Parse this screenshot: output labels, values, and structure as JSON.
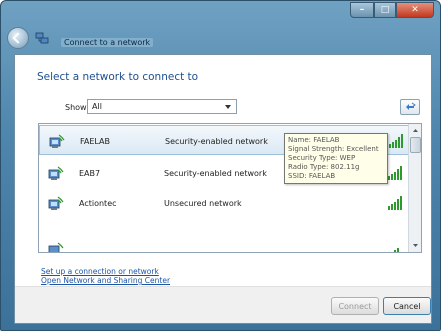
{
  "window": {
    "title": "Connect to a network",
    "caption": {
      "minimize": "–",
      "maximize": "□",
      "close": "✕"
    }
  },
  "main": {
    "heading": "Select a network to connect to",
    "show_label": "Show",
    "show_value": "All"
  },
  "networks": [
    {
      "name": "FAELAB",
      "security": "Security-enabled network",
      "signal_icon": "signal-excellent-icon",
      "selected": true
    },
    {
      "name": "EAB7",
      "security": "Security-enabled network",
      "signal_icon": "signal-excellent-icon",
      "selected": false
    },
    {
      "name": "Actiontec",
      "security": "Unsecured network",
      "signal_icon": "signal-excellent-icon",
      "selected": false
    },
    {
      "name": "",
      "security": "",
      "signal_icon": "signal-low-icon",
      "selected": false
    }
  ],
  "tooltip": {
    "name": "Name: FAELAB",
    "signal": "Signal Strength: Excellent",
    "security": "Security Type: WEP",
    "radio": "Radio Type: 802.11g",
    "ssid": "SSID: FAELAB"
  },
  "links": {
    "setup": "Set up a connection or network",
    "sharing_center": "Open Network and Sharing Center"
  },
  "buttons": {
    "connect": "Connect",
    "cancel": "Cancel"
  },
  "colors": {
    "accent": "#1e4f8f",
    "link": "#1c55a5",
    "signal": "#2e9a2e"
  }
}
